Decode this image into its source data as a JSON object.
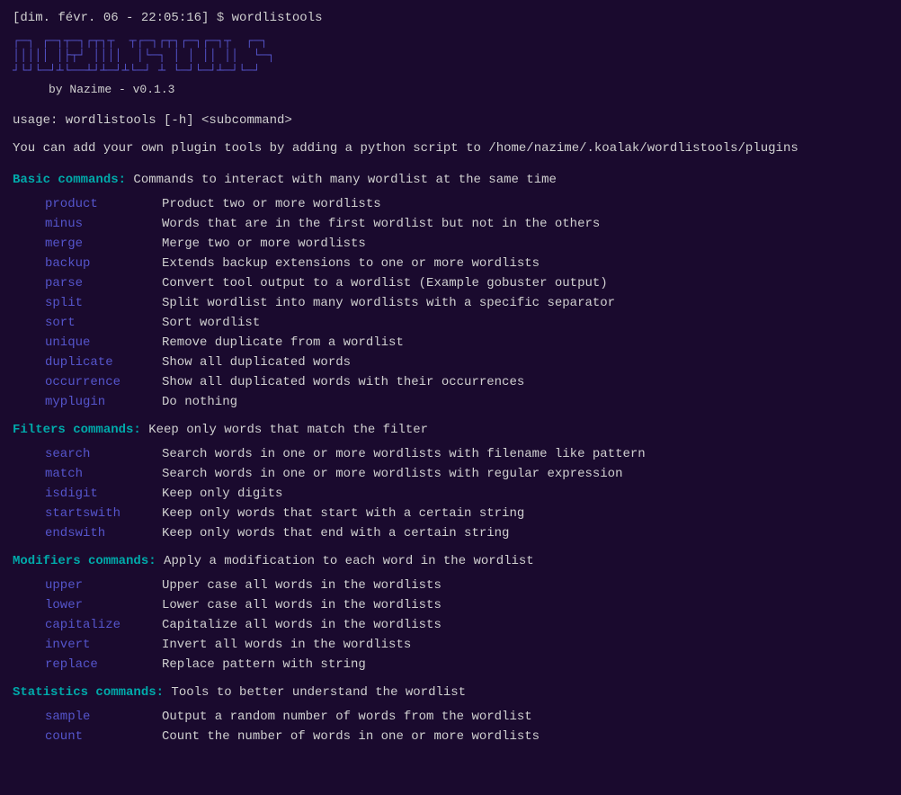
{
  "prompt": {
    "datetime": "[dim. févr. 06 - 22:05:16]",
    "dollar": "$",
    "command": "wordlistools"
  },
  "ascii_art": {
    "lines": [
      "┌─┐ ┌─┐┬─┐┌┬┐┬  ┬┌─┐┌┬┐┌─┐┌─┐┬  ┌─┐",
      "│││││ │├┬┘ ││││  │└─┐ │ │ ││ ││  └─┐",
      "┘└┘└─┘┴└──┴┘┴─┘┴└─┘ ┴ └─┘└─┘┴─┘└─┘"
    ],
    "by_line": "by Nazime - v0.1.3"
  },
  "usage": "usage: wordlistools [-h] <subcommand>",
  "plugin_info": "You can add your own plugin tools by adding a python script to /home/nazime/.koalak/wordlistools/plugins",
  "sections": [
    {
      "label": "Basic commands:",
      "desc": " Commands to interact with many wordlist at the same time",
      "commands": [
        {
          "name": "product",
          "desc": "Product two or more wordlists"
        },
        {
          "name": "minus",
          "desc": "Words that are in the first wordlist but not in the others"
        },
        {
          "name": "merge",
          "desc": "Merge two or more wordlists"
        },
        {
          "name": "backup",
          "desc": "Extends backup extensions to one or more wordlists"
        },
        {
          "name": "parse",
          "desc": "Convert tool output to a wordlist (Example gobuster output)"
        },
        {
          "name": "split",
          "desc": "Split wordlist into many wordlists with a specific separator"
        },
        {
          "name": "sort",
          "desc": "Sort wordlist"
        },
        {
          "name": "unique",
          "desc": "Remove duplicate from a wordlist"
        },
        {
          "name": "duplicate",
          "desc": "Show all duplicated words"
        },
        {
          "name": "occurrence",
          "desc": "Show all duplicated words with their occurrences"
        },
        {
          "name": "myplugin",
          "desc": "Do nothing"
        }
      ]
    },
    {
      "label": "Filters commands:",
      "desc": " Keep only words that match the filter",
      "commands": [
        {
          "name": "search",
          "desc": "Search words in one or more wordlists with filename like pattern"
        },
        {
          "name": "match",
          "desc": "Search words in one or more wordlists with regular expression"
        },
        {
          "name": "isdigit",
          "desc": "Keep only digits"
        },
        {
          "name": "startswith",
          "desc": "Keep only words that start with a certain string"
        },
        {
          "name": "endswith",
          "desc": "Keep only words that end with a certain string"
        }
      ]
    },
    {
      "label": "Modifiers commands:",
      "desc": " Apply a modification to each word in the wordlist",
      "commands": [
        {
          "name": "upper",
          "desc": "Upper case all words in the wordlists"
        },
        {
          "name": "lower",
          "desc": "Lower case all words in the wordlists"
        },
        {
          "name": "capitalize",
          "desc": "Capitalize all words in the wordlists"
        },
        {
          "name": "invert",
          "desc": "Invert all words in the wordlists"
        },
        {
          "name": "replace",
          "desc": "Replace pattern with string"
        }
      ]
    },
    {
      "label": "Statistics commands:",
      "desc": " Tools to better understand the wordlist",
      "commands": [
        {
          "name": "sample",
          "desc": "Output a random number of words from the wordlist"
        },
        {
          "name": "count",
          "desc": "Count the number of words in one or more wordlists"
        }
      ]
    }
  ]
}
